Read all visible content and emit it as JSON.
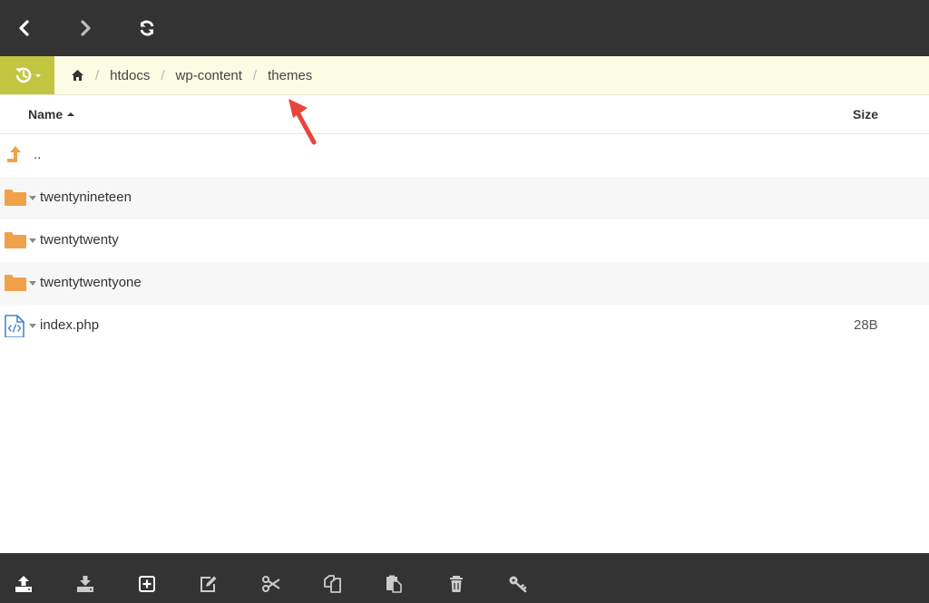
{
  "colors": {
    "toolbar_bg": "#333333",
    "breadcrumb_bg": "#fcfce4",
    "history_button_bg": "#c2c53f",
    "folder": "#f0a24a",
    "up_arrow": "#f0a24a",
    "file_icon": "#4a86c5",
    "annotation_arrow": "#e8453c"
  },
  "top_toolbar": {
    "back_icon": "chevron-left-icon",
    "forward_icon": "chevron-right-icon",
    "refresh_icon": "refresh-icon"
  },
  "breadcrumb": {
    "history_icon": "history-icon",
    "home_icon": "home-icon",
    "items": [
      "htdocs",
      "wp-content",
      "themes"
    ],
    "separator": "/"
  },
  "table": {
    "columns": {
      "name": "Name",
      "size": "Size"
    },
    "sort": "name-ascending",
    "rows": [
      {
        "type": "parent",
        "name": "..",
        "size": ""
      },
      {
        "type": "folder",
        "name": "twentynineteen",
        "size": ""
      },
      {
        "type": "folder",
        "name": "twentytwenty",
        "size": ""
      },
      {
        "type": "folder",
        "name": "twentytwentyone",
        "size": ""
      },
      {
        "type": "file",
        "name": "index.php",
        "size": "28B"
      }
    ]
  },
  "bottom_toolbar": {
    "icons": [
      "upload-icon",
      "download-icon",
      "new-item-icon",
      "edit-icon",
      "cut-icon",
      "copy-icon",
      "paste-icon",
      "delete-icon",
      "permissions-icon"
    ]
  }
}
